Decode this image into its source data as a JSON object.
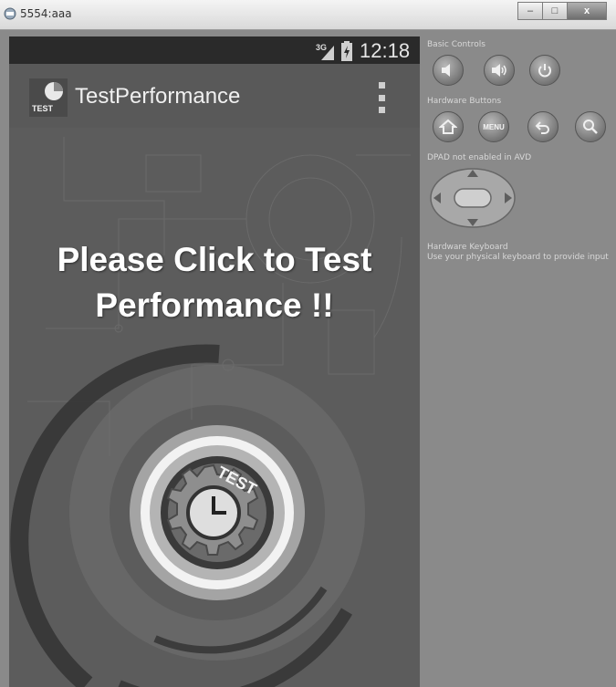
{
  "window": {
    "title": "5554:aaa",
    "minimize_glyph": "–",
    "maximize_glyph": "□",
    "close_glyph": "x"
  },
  "status_bar": {
    "network": "3G",
    "time": "12:18"
  },
  "action_bar": {
    "app_title": "TestPerformance",
    "logo_text": "TEST"
  },
  "main": {
    "headline": "Please Click to Test Performance !!",
    "button_text": "TEST"
  },
  "controls": {
    "basic_controls_label": "Basic Controls",
    "hardware_buttons_label": "Hardware Buttons",
    "menu_label": "MENU",
    "dpad_label": "DPAD not enabled in AVD",
    "keyboard_label": "Hardware Keyboard",
    "keyboard_hint": "Use your physical keyboard to provide input"
  },
  "icons": [
    "volume-down-icon",
    "volume-up-icon",
    "power-icon",
    "home-icon",
    "menu-icon",
    "back-icon",
    "search-icon",
    "dpad-icon"
  ]
}
